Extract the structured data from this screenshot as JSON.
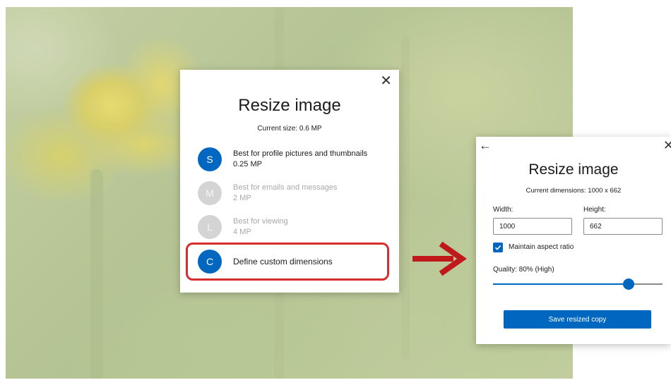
{
  "dialog1": {
    "title": "Resize image",
    "current_size": "Current size: 0.6 MP",
    "close_glyph": "✕",
    "options": [
      {
        "letter": "S",
        "label": "Best for profile pictures and thumbnails",
        "detail": "0.25 MP",
        "enabled": true
      },
      {
        "letter": "M",
        "label": "Best for emails and messages",
        "detail": "2 MP",
        "enabled": false
      },
      {
        "letter": "L",
        "label": "Best for viewing",
        "detail": "4 MP",
        "enabled": false
      },
      {
        "letter": "C",
        "label": "Define custom dimensions",
        "detail": "",
        "enabled": true
      }
    ]
  },
  "dialog2": {
    "title": "Resize image",
    "current_dimensions": "Current dimensions: 1000 x 662",
    "back_glyph": "←",
    "close_glyph": "✕",
    "width_label": "Width:",
    "width_value": "1000",
    "height_label": "Height:",
    "height_value": "662",
    "maintain_aspect_ratio": "Maintain aspect ratio",
    "maintain_checked": true,
    "quality_label": "Quality: 80% (High)",
    "quality_percent": 80,
    "save_button": "Save resized copy"
  },
  "colors": {
    "accent": "#0067c0",
    "highlight": "#d62d2d",
    "arrow": "#c0191b"
  }
}
